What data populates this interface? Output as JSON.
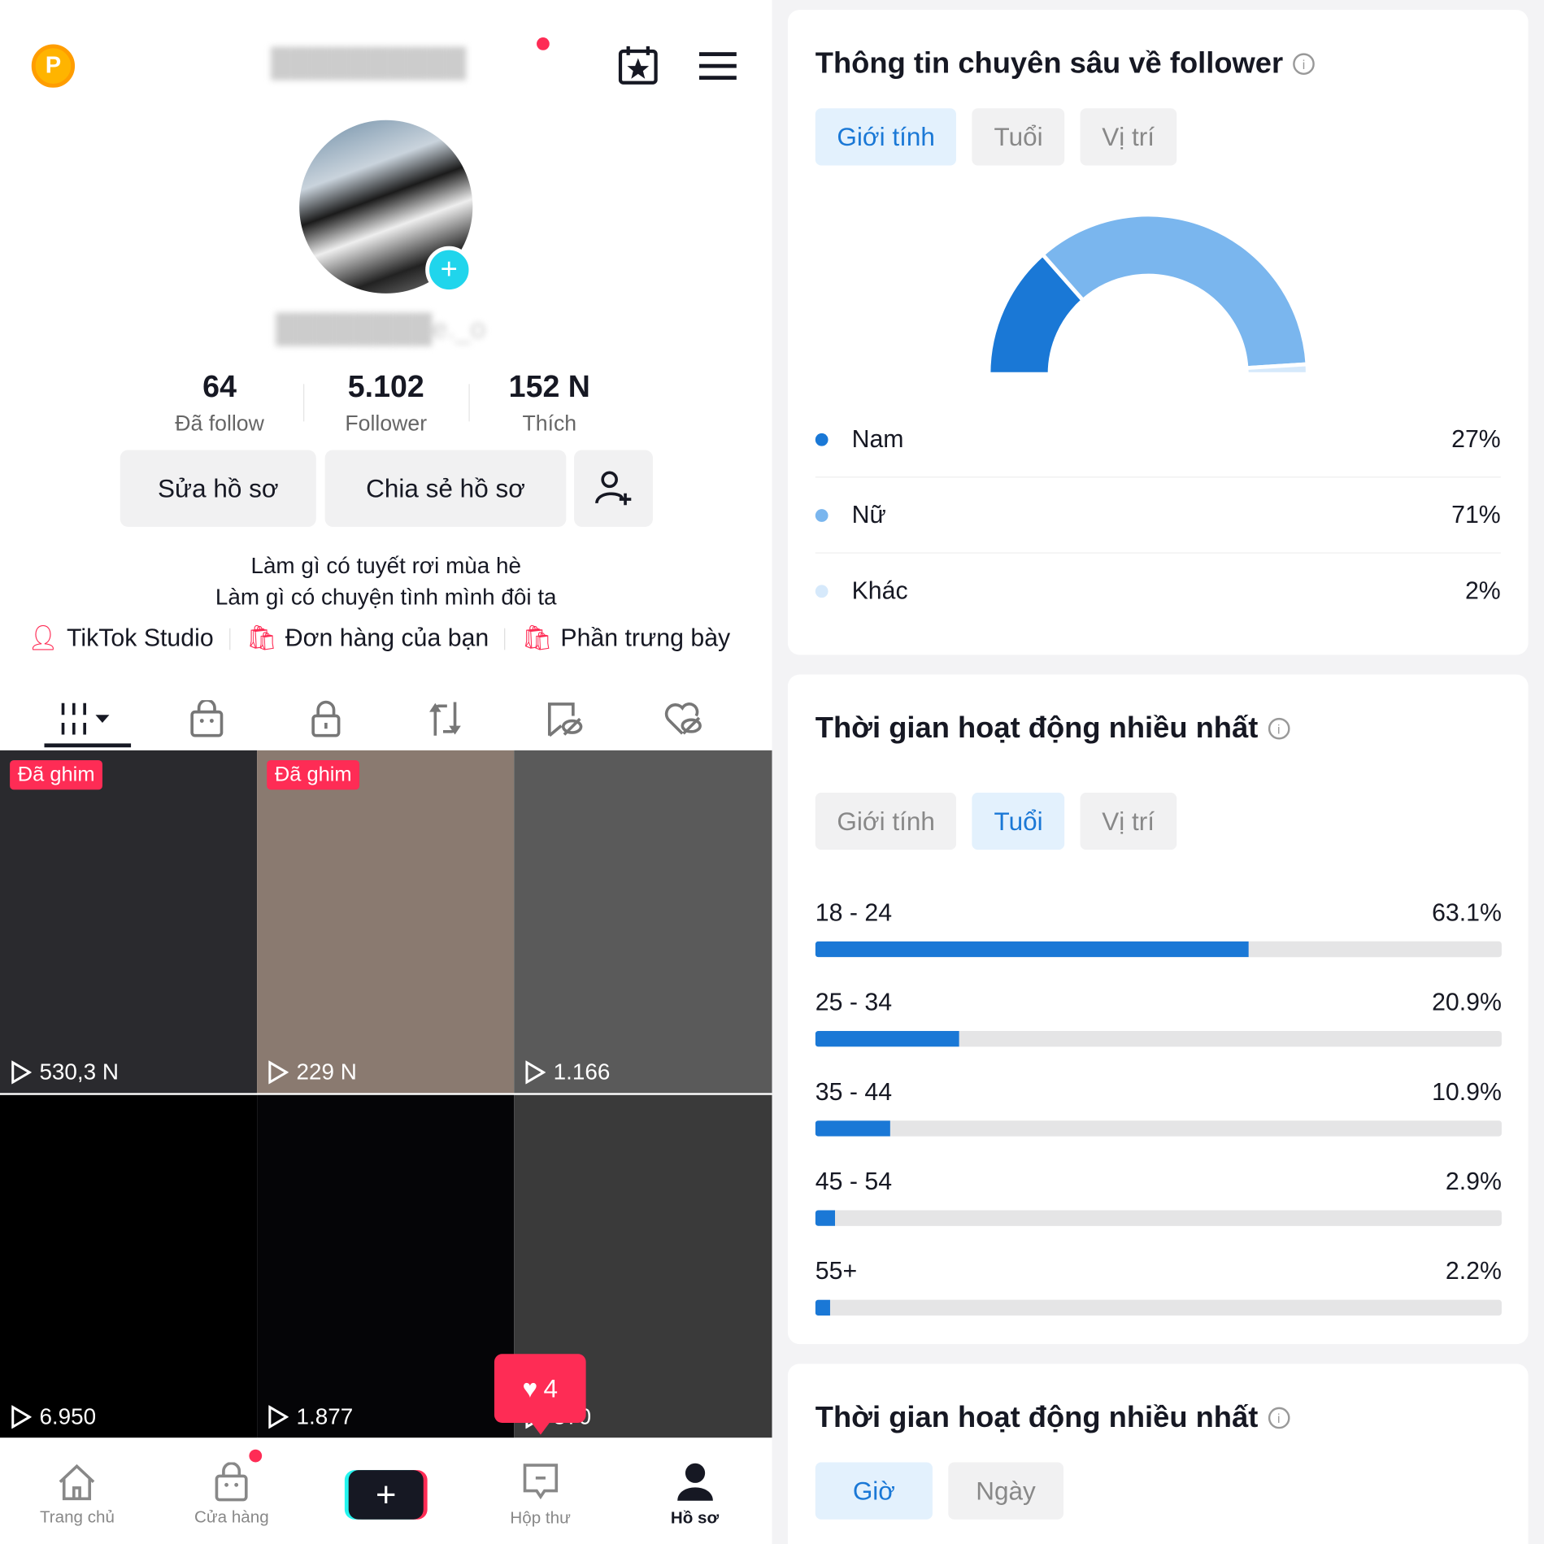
{
  "header": {
    "coin_label": "P"
  },
  "profile": {
    "stats": [
      {
        "value": "64",
        "label": "Đã follow"
      },
      {
        "value": "5.102",
        "label": "Follower"
      },
      {
        "value": "152 N",
        "label": "Thích"
      }
    ],
    "edit_button": "Sửa hồ sơ",
    "share_button": "Chia sẻ hồ sơ",
    "bio": [
      "Làm gì có tuyết rơi mùa hè",
      "Làm gì có chuyện tình mình đôi ta"
    ],
    "links": [
      "TikTok Studio",
      "Đơn hàng của bạn",
      "Phần trưng bày"
    ]
  },
  "videos": [
    {
      "pinned": "Đã ghim",
      "views": "530,3 N",
      "bg": "#2a2a2e"
    },
    {
      "pinned": "Đã ghim",
      "views": "229 N",
      "bg": "#8a7a70"
    },
    {
      "views": "1.166",
      "bg": "#5a5a5a"
    },
    {
      "views": "6.950",
      "bg": "#000000"
    },
    {
      "views": "1.877",
      "bg": "#050507"
    },
    {
      "views": "570",
      "bg": "#3a3a3a"
    }
  ],
  "like_notification": "4",
  "nav": [
    {
      "label": "Trang chủ"
    },
    {
      "label": "Cửa hàng"
    },
    {
      "label": ""
    },
    {
      "label": "Hộp thư"
    },
    {
      "label": "Hồ sơ"
    }
  ],
  "follower_insights": {
    "title": "Thông tin chuyên sâu về follower",
    "tabs": [
      "Giới tính",
      "Tuổi",
      "Vị trí"
    ],
    "active_tab": "Giới tính",
    "chart_data": {
      "type": "pie",
      "style": "semi-donut",
      "categories": [
        "Nam",
        "Nữ",
        "Khác"
      ],
      "values": [
        27,
        71,
        2
      ],
      "labels": [
        "27%",
        "71%",
        "2%"
      ],
      "colors": [
        "#1a78d6",
        "#7ab6ee",
        "#d6e9fb"
      ]
    }
  },
  "active_time_age": {
    "title": "Thời gian hoạt động nhiều nhất",
    "tabs": [
      "Giới tính",
      "Tuổi",
      "Vị trí"
    ],
    "active_tab": "Tuổi",
    "chart_data": {
      "type": "bar",
      "orientation": "horizontal",
      "categories": [
        "18 - 24",
        "25 - 34",
        "35 - 44",
        "45 - 54",
        "55+"
      ],
      "values": [
        63.1,
        20.9,
        10.9,
        2.9,
        2.2
      ],
      "labels": [
        "63.1%",
        "20.9%",
        "10.9%",
        "2.9%",
        "2.2%"
      ],
      "xlim": [
        0,
        100
      ],
      "color": "#1a78d6"
    }
  },
  "active_time_hours": {
    "title": "Thời gian hoạt động nhiều nhất",
    "tabs": [
      "Giờ",
      "Ngày"
    ],
    "active_tab": "Giờ"
  }
}
